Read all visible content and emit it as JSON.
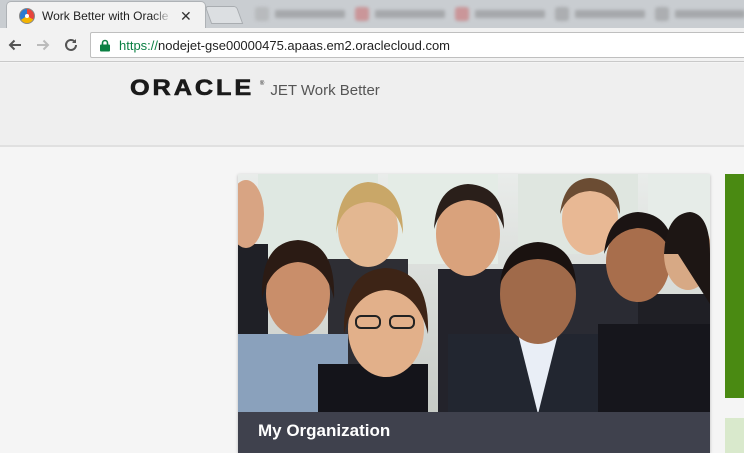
{
  "browser": {
    "active_tab": {
      "title": "Work Better with Oracle JET",
      "close_glyph": "✕"
    },
    "url": {
      "scheme": "https://",
      "host": "nodejet-gse00000475.apaas.em2.oraclecloud.com"
    }
  },
  "header": {
    "logo_text": "ORACLE",
    "logo_reg": "®",
    "app_name": "JET Work Better"
  },
  "cards": [
    {
      "title": "My Organization"
    }
  ],
  "colors": {
    "accent_green": "#4a8a12",
    "card_footer": "#3f414d",
    "secure_url": "#0b8043"
  }
}
